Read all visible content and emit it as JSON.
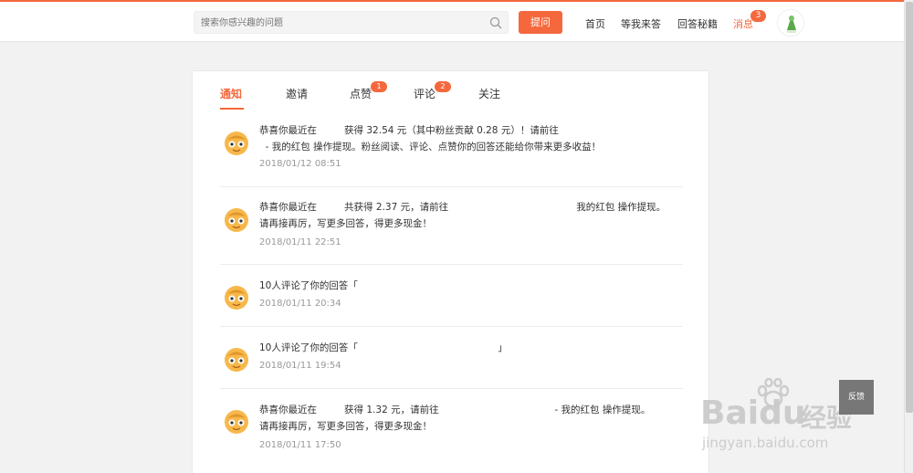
{
  "header": {
    "search_placeholder": "搜索你感兴趣的问题",
    "ask_label": "提问",
    "nav": [
      "首页",
      "等我来答",
      "回答秘籍",
      "消息"
    ],
    "message_count": "3"
  },
  "tabs": [
    {
      "label": "通知",
      "badge": ""
    },
    {
      "label": "邀请",
      "badge": ""
    },
    {
      "label": "点赞",
      "badge": "1"
    },
    {
      "label": "评论",
      "badge": "2"
    },
    {
      "label": "关注",
      "badge": ""
    }
  ],
  "notifications": [
    {
      "line1": "恭喜你最近在         获得 32.54 元（其中粉丝贡献 0.28 元）！请前往",
      "line2": "  - 我的红包 操作提现。粉丝阅读、评论、点赞你的回答还能给你带来更多收益！",
      "time": "2018/01/12 08:51"
    },
    {
      "line1": "恭喜你最近在         共获得 2.37 元，请前往                                          我的红包 操作提现。",
      "line2": "请再接再厉，写更多回答，得更多现金！",
      "time": "2018/01/11 22:51"
    },
    {
      "line1": "10人评论了你的回答「",
      "line2": "",
      "time": "2018/01/11 20:34"
    },
    {
      "line1": "10人评论了你的回答「                                              」",
      "line2": "",
      "time": "2018/01/11 19:54"
    },
    {
      "line1": "恭喜你最近在         获得 1.32 元，请前往                                      - 我的红包 操作提现。",
      "line2": "请再接再厉，写更多回答，得更多现金！",
      "time": "2018/01/11 17:50"
    }
  ],
  "feedback_label": "反馈",
  "watermark": {
    "brand": "Baidu",
    "suffix": "经验",
    "url": "jingyan.baidu.com"
  },
  "colors": {
    "accent": "#f5683d",
    "background": "#f2f2f2"
  }
}
